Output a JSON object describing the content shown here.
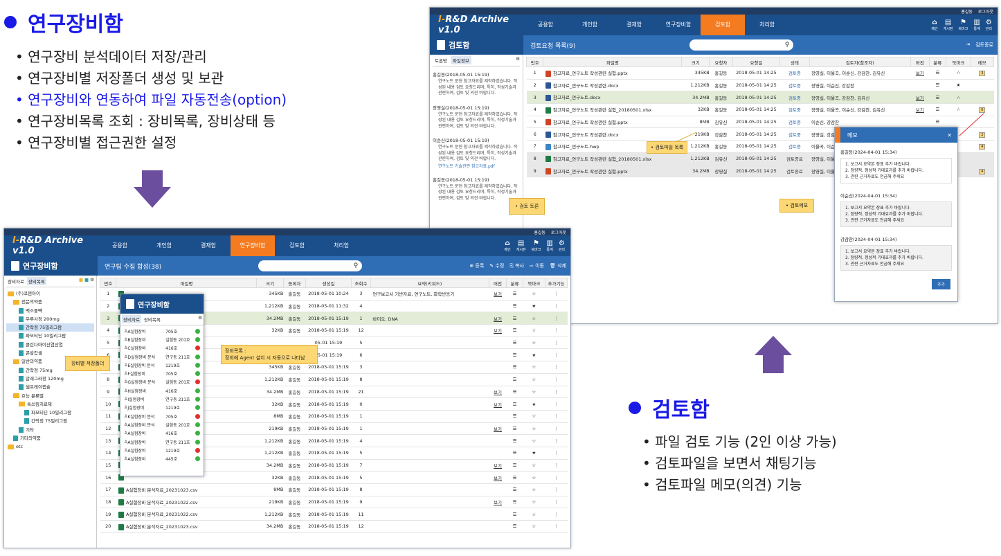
{
  "section1": {
    "title": "연구장비함",
    "bullets": [
      "연구장비 분석데이터 저장/관리",
      "연구장비별 저장폴더 생성 및 보관",
      "연구장비와 연동하여 파일 자동전송(option)",
      "연구장비목록 조회 : 장비목록, 장비상태 등",
      "연구장비별 접근권한 설정"
    ]
  },
  "section2": {
    "title": "검토함",
    "bullets": [
      "파일 검토 기능 (2인 이상 가능)",
      "검토파일을 보면서 채팅기능",
      "검토파일 메모(의견) 기능"
    ]
  },
  "colors": {
    "accent": "#1a1ae6",
    "nav": "#1b4f8c",
    "orange": "#f47b20",
    "arrow": "#6b4e9e"
  },
  "app": {
    "logo_prefix": "I-",
    "logo_main": "R&D Archive v1.0",
    "user": "홍길동",
    "logout": "로그아웃",
    "tabs": [
      "공용함",
      "개인함",
      "결재함",
      "연구장비함",
      "검토함",
      "처리함"
    ],
    "nav_icons": [
      {
        "icon": "home-icon",
        "label": "메인"
      },
      {
        "icon": "board-icon",
        "label": "게시판"
      },
      {
        "icon": "bookmark-icon",
        "label": "북마크"
      },
      {
        "icon": "stats-icon",
        "label": "통계"
      },
      {
        "icon": "gear-icon",
        "label": "관리"
      }
    ]
  },
  "review": {
    "title": "검토함",
    "list_title": "검토요청 목록(9)",
    "end_btn": "검토종료",
    "side_tabs": [
      "토론방",
      "파일정보"
    ],
    "comments": [
      {
        "head": "홍길동(2018-05-01 15:19)",
        "body": "연구노트 문헌 참고자료를 제작하였습니다. 작성된 내용 검토 요청드리며, 특히, 작성기술과 관련하여, 검토 및 의견 바랍니다.",
        "link": ""
      },
      {
        "head": "장영실(2018-05-01 15:19)",
        "body": "연구노트 문헌 참고자료를 제작하였습니다. 작성된 내용 검토 요청드리며, 특히, 작성기술과 관련하여, 검토 및 의견 바랍니다.",
        "link": ""
      },
      {
        "head": "이순신(2018-05-01 15:19)",
        "body": "연구노트 문헌 참고자료를 제작하였습니다. 작성된 내용 검토 요청드리며, 특히, 작성기술과 관련하여, 검토 및 의견 바랍니다.",
        "link": "연구노트 기술관련 참고자료.pdf"
      },
      {
        "head": "홍길동(2018-05-01 15:19)",
        "body": "연구노트 문헌 참고자료를 제작하였습니다. 작성된 내용 검토 요청드리며, 특히, 작성기술과 관련하여, 검토 및 의견 바랍니다.",
        "link": ""
      }
    ],
    "columns": [
      "번호",
      "파일명",
      "크기",
      "요청자",
      "요청일",
      "상태",
      "검토자(참조자)",
      "버전",
      "분류",
      "북마크",
      "메모"
    ],
    "rows": [
      {
        "n": "1",
        "t": "p",
        "name": "참고자료_연구노트 작성관련 실험.pptx",
        "size": "345KB",
        "req": "홍길동",
        "date": "2018-05-01 14:25",
        "st": "검토중",
        "rev": "장영실, 이율곡, 이순신, 강감찬, 김유신",
        "ver": "보기",
        "bm": "☆",
        "memo": "3",
        "cls": ""
      },
      {
        "n": "2",
        "t": "w",
        "name": "참고자료_연구노트 작성관련.docx",
        "size": "1,212KB",
        "req": "홍길동",
        "date": "2018-05-01 14:25",
        "st": "검토중",
        "rev": "장영실, 이순신, 강감찬",
        "ver": "",
        "bm": "★",
        "memo": "",
        "cls": ""
      },
      {
        "n": "3",
        "t": "w",
        "name": "참고자료_연구노트.docx",
        "size": "34.2MB",
        "req": "홍길동",
        "date": "2018-05-01 14:25",
        "st": "검토중",
        "rev": "장영실, 이율곡, 강감찬, 김유신",
        "ver": "보기",
        "bm": "☆",
        "memo": "",
        "cls": "g"
      },
      {
        "n": "4",
        "t": "x",
        "name": "참고자료_연구노트 작성관련 실험_20180501.xlsx",
        "size": "32KB",
        "req": "홍길동",
        "date": "2018-05-01 14:25",
        "st": "검토중",
        "rev": "장영실, 이율곡, 이순신, 강감찬, 김유신",
        "ver": "보기",
        "bm": "☆",
        "memo": "6",
        "cls": ""
      },
      {
        "n": "5",
        "t": "p",
        "name": "참고자료_연구노트 작성관련 실험.pptx",
        "size": "8MB",
        "req": "김유신",
        "date": "2018-05-01 14:25",
        "st": "검토중",
        "rev": "이순신, 강감찬",
        "ver": "",
        "bm": "",
        "memo": "",
        "cls": ""
      },
      {
        "n": "6",
        "t": "w",
        "name": "참고자료_연구노트 작성관련.docx",
        "size": "219KB",
        "req": "강감찬",
        "date": "2018-05-01 14:25",
        "st": "검토중",
        "rev": "장영실, 강감찬",
        "ver": "",
        "bm": "",
        "memo": "2",
        "cls": ""
      },
      {
        "n": "7",
        "t": "h",
        "name": "참고자료_연구노트.hwp",
        "size": "1,212KB",
        "req": "홍길동",
        "date": "2018-05-01 14:25",
        "st": "검토중",
        "rev": "이율곡, 이순신",
        "ver": "",
        "bm": "",
        "memo": "4",
        "cls": ""
      },
      {
        "n": "8",
        "t": "x",
        "name": "참고자료_연구노트 작성관련 실험_20180501.xlsx",
        "size": "1,212KB",
        "req": "김유신",
        "date": "2018-05-01 14:25",
        "st": "검토종료",
        "rev": "장영실, 이율곡",
        "ver": "",
        "bm": "",
        "memo": "",
        "cls": "gr"
      },
      {
        "n": "9",
        "t": "p",
        "name": "참고자료_연구노트 작성관련 실험.pptx",
        "size": "34.2MB",
        "req": "장영실",
        "date": "2018-05-01 14:25",
        "st": "검토종료",
        "rev": "장영실, 이율곡",
        "ver": "",
        "bm": "",
        "memo": "4",
        "cls": "gr"
      }
    ],
    "callouts": {
      "file_list": "• 검토파일 목록",
      "discussion": "• 검토 토론",
      "memo": "• 검토메모"
    },
    "memo": {
      "title": "메모",
      "entries": [
        {
          "head": "홍길동(2024-04-01 15:34)",
          "lines": [
            "1. 보고서 요약본 장표 추가 바랍니다.",
            "2. 정량적, 정성적 기대효과를 추가 바랍니다.",
            "3. 관련 근거자료도 언급해 주세요"
          ]
        },
        {
          "head": "이순신(2024-04-01 15:34)",
          "lines": [
            "1. 보고서 요약본 장표 추가 바랍니다.",
            "2. 정량적, 정성적 기대효과를 추가 바랍니다.",
            "3. 관련 근거자료도 언급해 주세요"
          ]
        },
        {
          "head": "강감찬(2024-04-01 15:34)",
          "lines": [
            "1. 보고서 요약본 장표 추가 바랍니다.",
            "2. 정량적, 정성적 기대효과를 추가 바랍니다.",
            "3. 관련 근거자료도 언급해 주세요"
          ]
        }
      ],
      "add_btn": "추가"
    }
  },
  "equip": {
    "title": "연구장비함",
    "list_title": "연구팀 수집 합성(38)",
    "actions": [
      "등록",
      "수정",
      "복사",
      "이동",
      "삭제"
    ],
    "side_tabs": [
      "장비자료",
      "장비목록"
    ],
    "tree": [
      {
        "lv": 0,
        "t": "f",
        "label": "(주)코젠아이"
      },
      {
        "lv": 1,
        "t": "f",
        "label": "전문의약품"
      },
      {
        "lv": 2,
        "t": "d",
        "label": "벡소좋빽"
      },
      {
        "lv": 2,
        "t": "d",
        "label": "우루사정 200mg"
      },
      {
        "lv": 2,
        "t": "d",
        "label": "간락정 75밀리그람"
      },
      {
        "lv": 2,
        "t": "d",
        "label": "파모티딘 10밀리그람"
      },
      {
        "lv": 2,
        "t": "d",
        "label": "클린다마이신염산염"
      },
      {
        "lv": 2,
        "t": "d",
        "label": "콘발캅셀"
      },
      {
        "lv": 1,
        "t": "f",
        "label": "일반의약품"
      },
      {
        "lv": 2,
        "t": "d",
        "label": "간락정 75mg"
      },
      {
        "lv": 2,
        "t": "d",
        "label": "알레그라정 120mg"
      },
      {
        "lv": 2,
        "t": "d",
        "label": "셀프레이캡슐"
      },
      {
        "lv": 1,
        "t": "f",
        "label": "효능 분류별"
      },
      {
        "lv": 2,
        "t": "f",
        "label": "속쓰림치료제"
      },
      {
        "lv": 3,
        "t": "d",
        "label": "파모티딘 10밀리그람"
      },
      {
        "lv": 3,
        "t": "d",
        "label": "간락정 75밀리그람"
      },
      {
        "lv": 2,
        "t": "d",
        "label": "기타"
      },
      {
        "lv": 1,
        "t": "d",
        "label": "기타의약품"
      },
      {
        "lv": 0,
        "t": "f",
        "label": "etc"
      }
    ],
    "columns": [
      "번호",
      "파일명",
      "크기",
      "등록자",
      "생성일",
      "조회수",
      "요약(키워드)",
      "버전",
      "분류",
      "북마크",
      "추가기능"
    ],
    "rows": [
      {
        "n": "1",
        "name": "",
        "size": "345KB",
        "reg": "홍길동",
        "date": "2018-05-01 10:24",
        "views": "3",
        "kw": "연구보고서 기반자료, 연구노트, 화학반응기",
        "ver": "보기",
        "bm": "☆",
        "cls": ""
      },
      {
        "n": "2",
        "name": "",
        "size": "1,212KB",
        "reg": "홍길동",
        "date": "2018-05-01 11:32",
        "views": "4",
        "kw": "",
        "ver": "",
        "bm": "★",
        "cls": ""
      },
      {
        "n": "3",
        "name": "",
        "size": "34.2MB",
        "reg": "홍길동",
        "date": "2018-05-01 15:19",
        "views": "1",
        "kw": "바이오, DNA",
        "ver": "보기",
        "bm": "☆",
        "cls": "g"
      },
      {
        "n": "4",
        "name": "",
        "size": "32KB",
        "reg": "홍길동",
        "date": "2018-05-01 15:19",
        "views": "12",
        "kw": "",
        "ver": "보기",
        "bm": "☆",
        "cls": ""
      },
      {
        "n": "5",
        "name": "",
        "size": "",
        "reg": "",
        "date": "05-01 15:19",
        "views": "5",
        "kw": "",
        "ver": "",
        "bm": "☆",
        "cls": ""
      },
      {
        "n": "6",
        "name": "",
        "size": "",
        "reg": "",
        "date": "05-01 15:19",
        "views": "6",
        "kw": "",
        "ver": "",
        "bm": "★",
        "cls": ""
      },
      {
        "n": "7",
        "name": "",
        "size": "345KB",
        "reg": "홍길동",
        "date": "2018-05-01 15:19",
        "views": "3",
        "kw": "",
        "ver": "",
        "bm": "☆",
        "cls": ""
      },
      {
        "n": "8",
        "name": "",
        "size": "1,212KB",
        "reg": "홍길동",
        "date": "2018-05-01 15:19",
        "views": "8",
        "kw": "",
        "ver": "",
        "bm": "☆",
        "cls": ""
      },
      {
        "n": "9",
        "name": "",
        "size": "34.2MB",
        "reg": "홍길동",
        "date": "2018-05-01 15:19",
        "views": "21",
        "kw": "",
        "ver": "보기",
        "bm": "☆",
        "cls": ""
      },
      {
        "n": "10",
        "name": "",
        "size": "32KB",
        "reg": "홍길동",
        "date": "2018-05-01 15:19",
        "views": "0",
        "kw": "",
        "ver": "보기",
        "bm": "★",
        "cls": ""
      },
      {
        "n": "11",
        "name": "",
        "size": "8MB",
        "reg": "홍길동",
        "date": "2018-05-01 15:19",
        "views": "1",
        "kw": "",
        "ver": "",
        "bm": "☆",
        "cls": ""
      },
      {
        "n": "12",
        "name": "",
        "size": "219KB",
        "reg": "홍길동",
        "date": "2018-05-01 15:19",
        "views": "1",
        "kw": "",
        "ver": "보기",
        "bm": "☆",
        "cls": ""
      },
      {
        "n": "13",
        "name": "",
        "size": "1,212KB",
        "reg": "홍길동",
        "date": "2018-05-01 15:19",
        "views": "4",
        "kw": "",
        "ver": "",
        "bm": "☆",
        "cls": ""
      },
      {
        "n": "14",
        "name": "",
        "size": "1,212KB",
        "reg": "홍길동",
        "date": "2018-05-01 15:19",
        "views": "5",
        "kw": "",
        "ver": "",
        "bm": "★",
        "cls": ""
      },
      {
        "n": "15",
        "name": "",
        "size": "34.2MB",
        "reg": "홍길동",
        "date": "2018-05-01 15:19",
        "views": "7",
        "kw": "",
        "ver": "보기",
        "bm": "☆",
        "cls": ""
      },
      {
        "n": "16",
        "name": "",
        "size": "32KB",
        "reg": "홍길동",
        "date": "2018-05-01 15:19",
        "views": "5",
        "kw": "",
        "ver": "보기",
        "bm": "☆",
        "cls": ""
      },
      {
        "n": "17",
        "name": "A실험장비 분석자료_20231023.csv",
        "size": "8MB",
        "reg": "홍길동",
        "date": "2018-05-01 15:19",
        "views": "8",
        "kw": "",
        "ver": "",
        "bm": "☆",
        "cls": ""
      },
      {
        "n": "18",
        "name": "A실험장비 분석자료_20231022.csv",
        "size": "219KB",
        "reg": "홍길동",
        "date": "2018-05-01 15:19",
        "views": "9",
        "kw": "",
        "ver": "보기",
        "bm": "☆",
        "cls": ""
      },
      {
        "n": "19",
        "name": "A실험장비 분석자료_20231022.csv",
        "size": "1,212KB",
        "reg": "홍길동",
        "date": "2018-05-01 15:19",
        "views": "11",
        "kw": "",
        "ver": "",
        "bm": "☆",
        "cls": ""
      },
      {
        "n": "20",
        "name": "A실험장비 분석자료_20231023.csv",
        "size": "34.2MB",
        "reg": "홍길동",
        "date": "2018-05-01 15:19",
        "views": "12",
        "kw": "",
        "ver": "",
        "bm": "☆",
        "cls": ""
      }
    ],
    "popup": {
      "title": "연구장비함",
      "tabs": [
        "장비자료",
        "장비목록"
      ],
      "items": [
        {
          "name": "A실험장비",
          "loc": "705호",
          "ok": true
        },
        {
          "name": "B실험장비",
          "loc": "실험동 201호",
          "ok": true
        },
        {
          "name": "C실험장비",
          "loc": "416호",
          "ok": false
        },
        {
          "name": "D실험장비 분석",
          "loc": "연구동 211호",
          "ok": true
        },
        {
          "name": "E실험장비 분석",
          "loc": "1219호",
          "ok": true
        },
        {
          "name": "F실험장비",
          "loc": "705호",
          "ok": true
        },
        {
          "name": "G실험장비 분석",
          "loc": "실험동 201호",
          "ok": false
        },
        {
          "name": "H실험장비",
          "loc": "416호",
          "ok": true
        },
        {
          "name": "I실험장비",
          "loc": "연구동 211호",
          "ok": true
        },
        {
          "name": "J실험장비",
          "loc": "1219호",
          "ok": true
        },
        {
          "name": "K실험장비 분석",
          "loc": "705호",
          "ok": false
        },
        {
          "name": "A실험장비 분석",
          "loc": "실험동 201호",
          "ok": true
        },
        {
          "name": "A실험장비",
          "loc": "416호",
          "ok": true
        },
        {
          "name": "A실험장비",
          "loc": "연구동 211호",
          "ok": true
        },
        {
          "name": "A실험장비",
          "loc": "1219호",
          "ok": false
        },
        {
          "name": "A실험장비",
          "loc": "445호",
          "ok": true
        }
      ]
    },
    "callouts": {
      "folder": "장비별 저장폴더",
      "agent_title": "장비목록 :",
      "agent_body": "장비에 Agent 설치 시 자동으로 나타남"
    }
  }
}
